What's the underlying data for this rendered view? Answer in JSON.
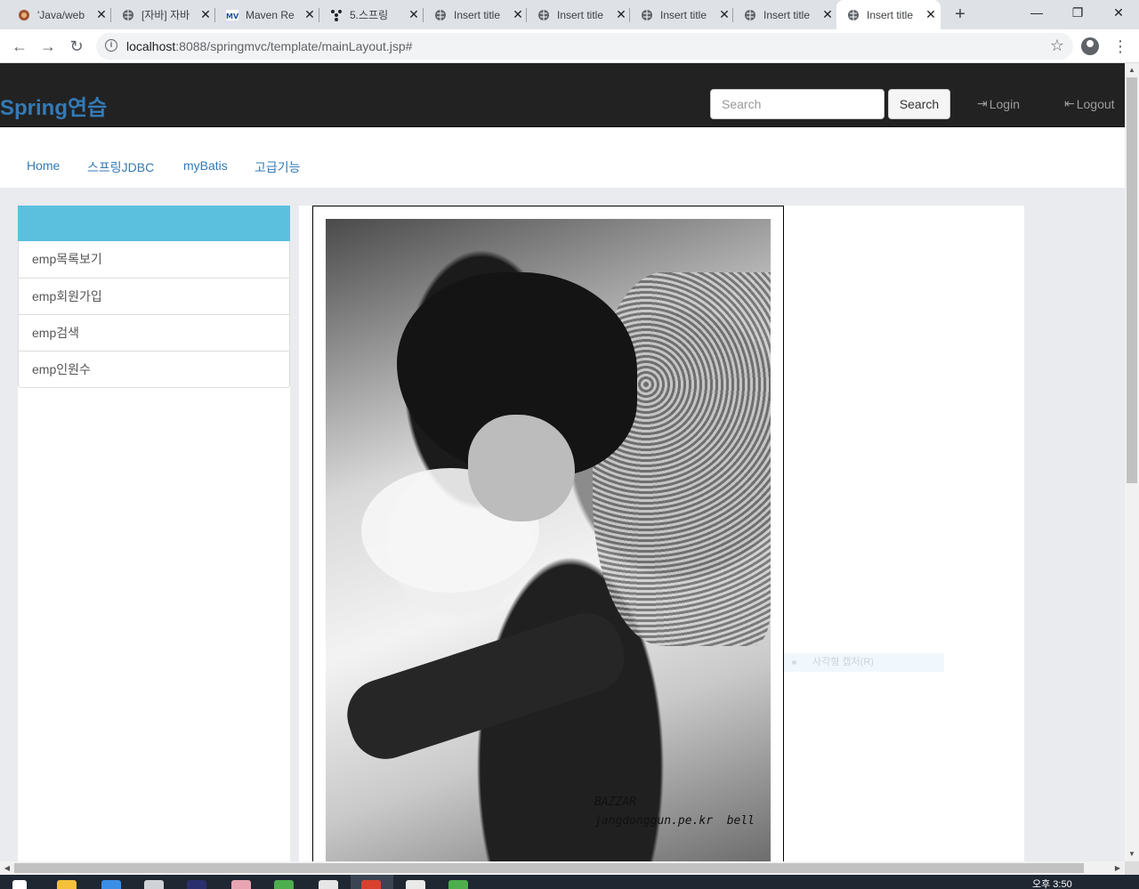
{
  "browser": {
    "tabs": [
      {
        "title": "'Java/web",
        "favicon": "pie-icon"
      },
      {
        "title": "[자바] 자바",
        "favicon": "globe-icon"
      },
      {
        "title": "Maven Re",
        "favicon": "mvn-icon"
      },
      {
        "title": "5.스프링",
        "favicon": "tree-icon"
      },
      {
        "title": "Insert title",
        "favicon": "globe-icon"
      },
      {
        "title": "Insert title",
        "favicon": "globe-icon"
      },
      {
        "title": "Insert title",
        "favicon": "globe-icon"
      },
      {
        "title": "Insert title",
        "favicon": "globe-icon"
      },
      {
        "title": "Insert title",
        "favicon": "globe-icon"
      }
    ],
    "active_tab_index": 8,
    "url_host": "localhost",
    "url_rest": ":8088/springmvc/template/mainLayout.jsp#"
  },
  "site": {
    "brand": "Spring연습",
    "search_placeholder": "Search",
    "search_button": "Search",
    "login_label": "Login",
    "logout_label": "Logout"
  },
  "menu": {
    "items": [
      "Home",
      "스프링JDBC",
      "myBatis",
      "고급기능"
    ]
  },
  "sidebar": {
    "items": [
      "emp목록보기",
      "emp회원가입",
      "emp검색",
      "emp인원수"
    ]
  },
  "content": {
    "photo_caption_line1": "BAZZAR",
    "photo_caption_line2": "jangdonggun.pe.kr  bell",
    "overlay_text": "사각형 캡처(R)"
  },
  "taskbar": {
    "clock": "오후 3:50"
  },
  "colors": {
    "brand": "#337ab7",
    "header_bg": "#222222",
    "sidebar_head": "#5bc0de"
  }
}
